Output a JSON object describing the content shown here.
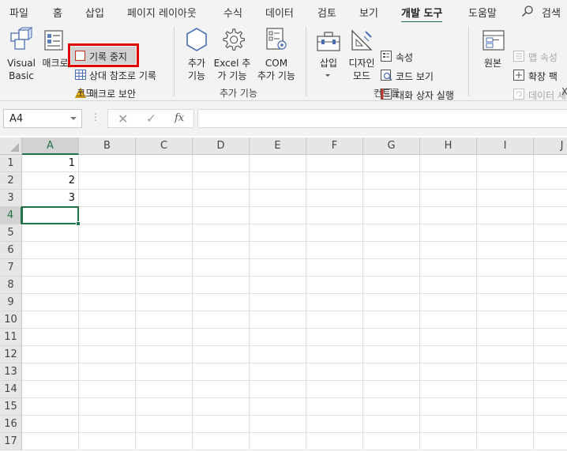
{
  "tabs": [
    {
      "label": "파일"
    },
    {
      "label": "홈"
    },
    {
      "label": "삽입"
    },
    {
      "label": "페이지 레이아웃"
    },
    {
      "label": "수식"
    },
    {
      "label": "데이터"
    },
    {
      "label": "검토"
    },
    {
      "label": "보기"
    },
    {
      "label": "개발 도구",
      "active": true
    },
    {
      "label": "도움말"
    }
  ],
  "search": {
    "label": "검색",
    "icon": "search-icon"
  },
  "ribbon": {
    "code": {
      "visual_basic": [
        "Visual",
        "Basic"
      ],
      "macro": "매크로",
      "record_stop": "기록 중지",
      "relative_ref": "상대 참조로 기록",
      "macro_security": "매크로 보안",
      "group_label": "코드"
    },
    "addins": {
      "addins": [
        "추가",
        "기능"
      ],
      "excel_addins": [
        "Excel 추",
        "가 기능"
      ],
      "com_addins": [
        "COM",
        "추가 기능"
      ],
      "group_label": "추가 기능"
    },
    "controls": {
      "insert": "삽입",
      "design_mode": [
        "디자인",
        "모드"
      ],
      "properties": "속성",
      "view_code": "코드 보기",
      "run_dialog": "대화 상자 실행",
      "group_label": "컨트롤"
    },
    "xml": {
      "source": "원본",
      "map_properties": "맵 속성",
      "expansion_packs": "확장 팩",
      "refresh_data": "데이터 새",
      "group_label": "X"
    }
  },
  "formula_bar": {
    "name_box": "A4",
    "cancel": "✕",
    "enter": "✓",
    "fx": "fx",
    "value": ""
  },
  "grid": {
    "columns": [
      "A",
      "B",
      "C",
      "D",
      "E",
      "F",
      "G",
      "H",
      "I",
      "J"
    ],
    "rows": [
      "1",
      "2",
      "3",
      "4",
      "5",
      "6",
      "7",
      "8",
      "9",
      "10",
      "11",
      "12",
      "13",
      "14",
      "15",
      "16",
      "17"
    ],
    "cells": {
      "A1": "1",
      "A2": "2",
      "A3": "3"
    },
    "active_cell": "A4",
    "accent": "#217346"
  },
  "colors": {
    "accent": "#217346",
    "highlight": "#e00000"
  }
}
